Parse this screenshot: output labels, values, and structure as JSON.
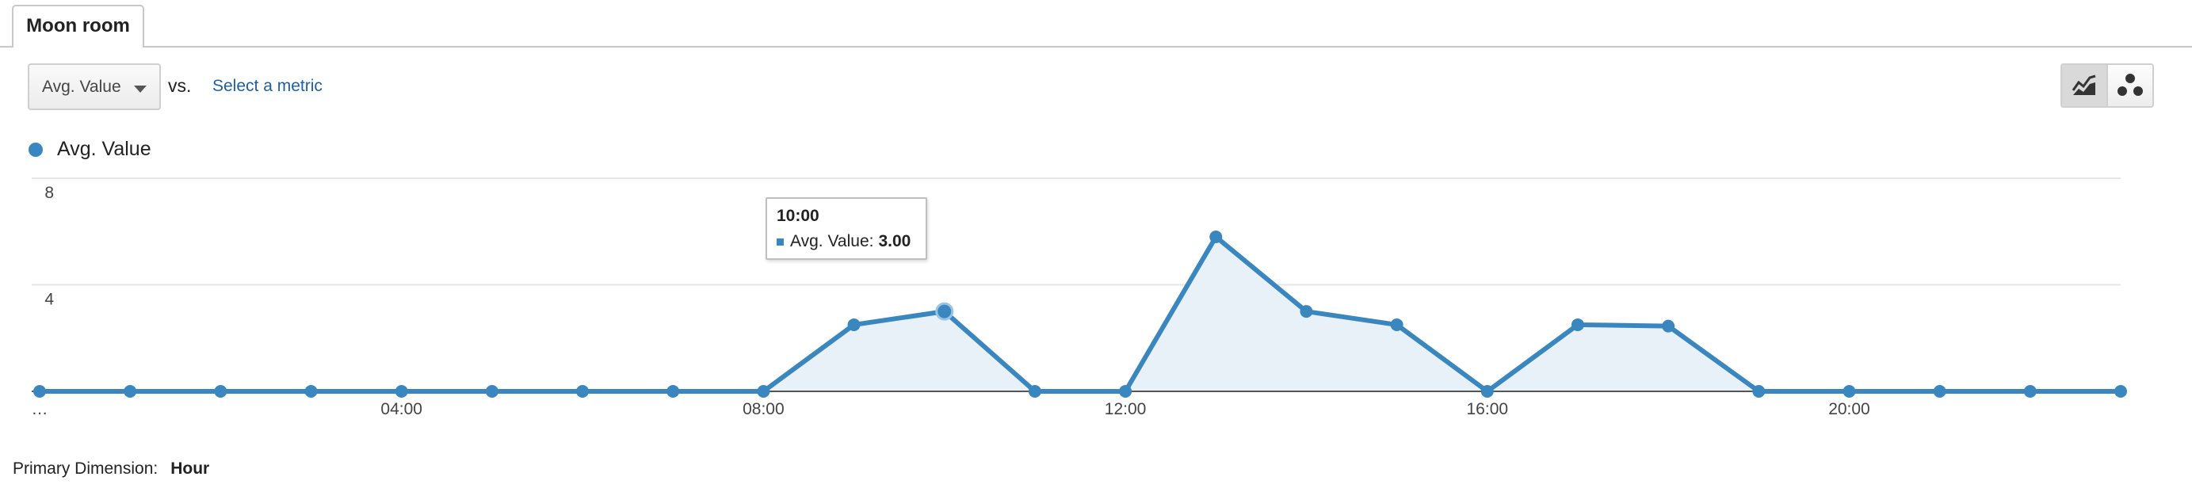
{
  "tab": {
    "label": "Moon room"
  },
  "controls": {
    "metric_selected": "Avg. Value",
    "vs_label": "vs.",
    "select_metric_link": "Select a metric"
  },
  "legend": {
    "label": "Avg. Value",
    "color": "#3a87c0"
  },
  "tooltip": {
    "time": "10:00",
    "metric_label": "Avg. Value:",
    "value": "3.00"
  },
  "footer": {
    "label": "Primary Dimension:",
    "value": "Hour"
  },
  "icons": {
    "line_chart_view": "line-chart-icon",
    "motion_chart_view": "bubble-chart-icon"
  },
  "chart_data": {
    "type": "area",
    "x": [
      "…",
      "01:00",
      "02:00",
      "03:00",
      "04:00",
      "05:00",
      "06:00",
      "07:00",
      "08:00",
      "09:00",
      "10:00",
      "11:00",
      "12:00",
      "13:00",
      "14:00",
      "15:00",
      "16:00",
      "17:00",
      "18:00",
      "19:00",
      "20:00",
      "21:00",
      "22:00",
      "23:00"
    ],
    "x_tick_labels": [
      "…",
      "04:00",
      "08:00",
      "12:00",
      "16:00",
      "20:00"
    ],
    "x_tick_indices": [
      0,
      4,
      8,
      12,
      16,
      20
    ],
    "series": [
      {
        "name": "Avg. Value",
        "color": "#3a87c0",
        "values": [
          0,
          0,
          0,
          0,
          0,
          0,
          0,
          0,
          0,
          2.5,
          3.0,
          0,
          0,
          5.8,
          3.0,
          2.5,
          0,
          2.5,
          2.45,
          0,
          0,
          0,
          0,
          0
        ]
      }
    ],
    "ylim": [
      0,
      8
    ],
    "y_ticks": [
      4,
      8
    ],
    "highlight_index": 10,
    "grid": true
  }
}
